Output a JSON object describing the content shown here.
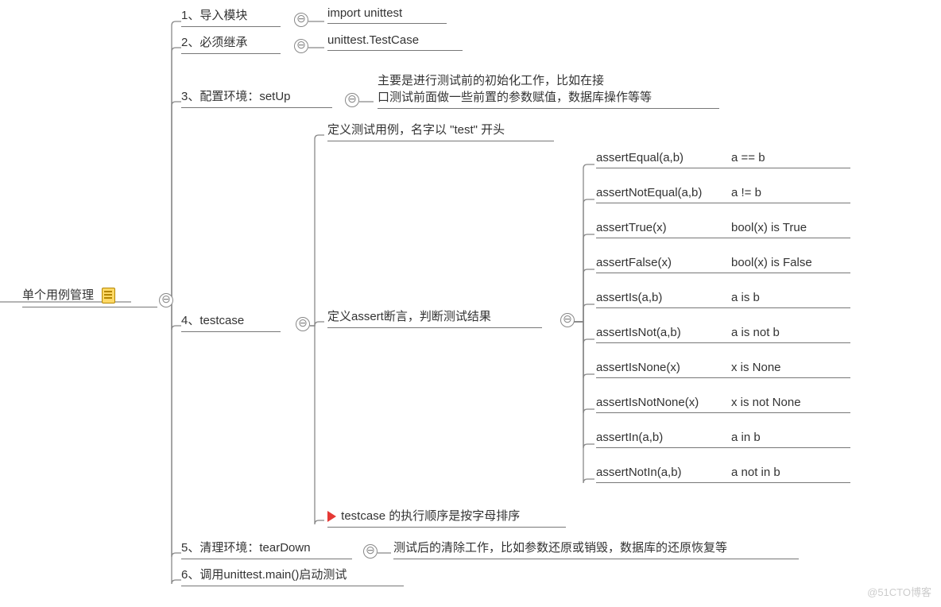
{
  "root": {
    "title": "单个用例管理"
  },
  "nodes": {
    "n1": {
      "label": "1、导入模块",
      "detail": "import unittest"
    },
    "n2": {
      "label": "2、必须继承",
      "detail": "unittest.TestCase"
    },
    "n3": {
      "label": "3、配置环境：setUp",
      "detail_line1": "主要是进行测试前的初始化工作，比如在接",
      "detail_line2": "口测试前面做一些前置的参数赋值，数据库操作等等"
    },
    "n4": {
      "label": "4、testcase",
      "child_a": "定义测试用例，名字以 \"test\" 开头",
      "child_b": "定义assert断言，判断测试结果",
      "child_c": "testcase 的执行顺序是按字母排序"
    },
    "n5": {
      "label": "5、清理环境：tearDown",
      "detail": "测试后的清除工作，比如参数还原或销毁，数据库的还原恢复等"
    },
    "n6": {
      "label": "6、调用unittest.main()启动测试"
    }
  },
  "asserts": [
    {
      "method": "assertEqual(a,b)",
      "meaning": "a == b"
    },
    {
      "method": "assertNotEqual(a,b)",
      "meaning": "a != b"
    },
    {
      "method": "assertTrue(x)",
      "meaning": "bool(x) is True"
    },
    {
      "method": "assertFalse(x)",
      "meaning": "bool(x) is False"
    },
    {
      "method": "assertIs(a,b)",
      "meaning": "a is b"
    },
    {
      "method": "assertIsNot(a,b)",
      "meaning": "a is not b"
    },
    {
      "method": "assertIsNone(x)",
      "meaning": "x is None"
    },
    {
      "method": "assertIsNotNone(x)",
      "meaning": "x is not None"
    },
    {
      "method": "assertIn(a,b)",
      "meaning": "a in b"
    },
    {
      "method": "assertNotIn(a,b)",
      "meaning": "a not in b"
    }
  ],
  "watermark": "@51CTO博客",
  "collapse_glyph": "⊖"
}
